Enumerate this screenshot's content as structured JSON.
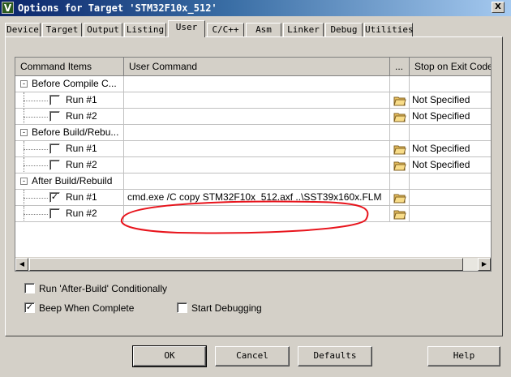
{
  "window": {
    "app_icon_letter": "V",
    "title": "Options for Target 'STM32F10x_512'",
    "close_glyph": "X"
  },
  "tabs": [
    {
      "label": "Device",
      "active": false
    },
    {
      "label": "Target",
      "active": false
    },
    {
      "label": "Output",
      "active": false
    },
    {
      "label": "Listing",
      "active": false
    },
    {
      "label": "User",
      "active": true
    },
    {
      "label": "C/C++",
      "active": false
    },
    {
      "label": "Asm",
      "active": false
    },
    {
      "label": "Linker",
      "active": false
    },
    {
      "label": "Debug",
      "active": false
    },
    {
      "label": "Utilities",
      "active": false
    }
  ],
  "grid": {
    "headers": [
      "Command Items",
      "User Command",
      "...",
      "Stop on Exit Code"
    ],
    "groups": [
      {
        "label": "Before Compile C...",
        "expander": "-"
      },
      {
        "label": "Before Build/Rebu...",
        "expander": "-"
      },
      {
        "label": "After Build/Rebuild",
        "expander": "-"
      }
    ],
    "rows": [
      {
        "type": "group",
        "group": 0
      },
      {
        "type": "item",
        "label": "Run #1",
        "checked": false,
        "command": "",
        "stop": "Not Specified"
      },
      {
        "type": "item",
        "label": "Run #2",
        "checked": false,
        "command": "",
        "stop": "Not Specified"
      },
      {
        "type": "group",
        "group": 1
      },
      {
        "type": "item",
        "label": "Run #1",
        "checked": false,
        "command": "",
        "stop": "Not Specified"
      },
      {
        "type": "item",
        "label": "Run #2",
        "checked": false,
        "command": "",
        "stop": "Not Specified"
      },
      {
        "type": "group",
        "group": 2
      },
      {
        "type": "item",
        "label": "Run #1",
        "checked": true,
        "command": "cmd.exe /C copy STM32F10x_512.axf ..\\SST39x160x.FLM",
        "stop": ""
      },
      {
        "type": "item",
        "label": "Run #2",
        "checked": false,
        "command": "",
        "stop": ""
      }
    ],
    "scroll_left_glyph": "◀",
    "scroll_right_glyph": "▶"
  },
  "options": {
    "run_after_build": {
      "label": "Run 'After-Build' Conditionally",
      "checked": false
    },
    "beep": {
      "label": "Beep When Complete",
      "checked": true
    },
    "start_debugging": {
      "label": "Start Debugging",
      "checked": false
    }
  },
  "buttons": {
    "ok": "OK",
    "cancel": "Cancel",
    "defaults": "Defaults",
    "help": "Help"
  },
  "annotation": {
    "color": "#e8141c",
    "shape": "hand-drawn ellipse around command"
  },
  "colors": {
    "title_start": "#0a246a",
    "title_end": "#a6caf0",
    "face": "#d4d0c8"
  },
  "icons": {
    "folder": "folder-open-icon",
    "checkmark": "checkmark-icon"
  }
}
